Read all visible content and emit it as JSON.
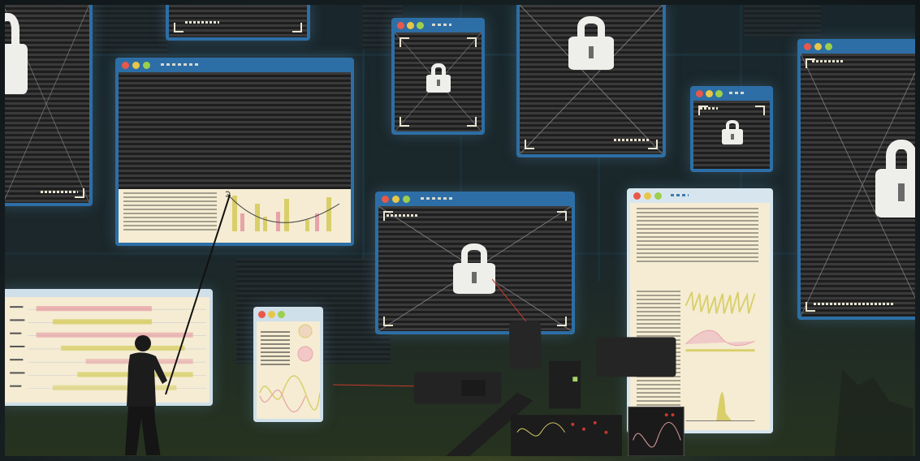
{
  "scene": {
    "description_tags": [
      "windows",
      "padlock",
      "person",
      "camera-rig"
    ],
    "colors": {
      "window_frame": "#2d6ea6",
      "paper": "#f5ecd3",
      "lock": "#eeeeea",
      "accent_yellow": "#c8c24a",
      "accent_pink": "#e7a3a8",
      "laser": "#c8392c"
    }
  },
  "windows": [
    {
      "id": "w-top-left",
      "content": "locked"
    },
    {
      "id": "w-top-center-small",
      "content": "plain"
    },
    {
      "id": "w-chart",
      "content": "chart"
    },
    {
      "id": "w-lock-small-1",
      "content": "locked"
    },
    {
      "id": "w-lock-tall",
      "content": "locked"
    },
    {
      "id": "w-lock-small-2",
      "content": "locked"
    },
    {
      "id": "w-lock-right",
      "content": "locked"
    },
    {
      "id": "w-lock-center",
      "content": "locked"
    },
    {
      "id": "w-document-right",
      "content": "document"
    },
    {
      "id": "w-document-small",
      "content": "document"
    },
    {
      "id": "w-bars-left",
      "content": "timeline"
    }
  ],
  "icons": {
    "window_buttons": [
      "close-dot",
      "minimize-dot",
      "maximize-dot"
    ],
    "lock": "padlock-icon"
  }
}
